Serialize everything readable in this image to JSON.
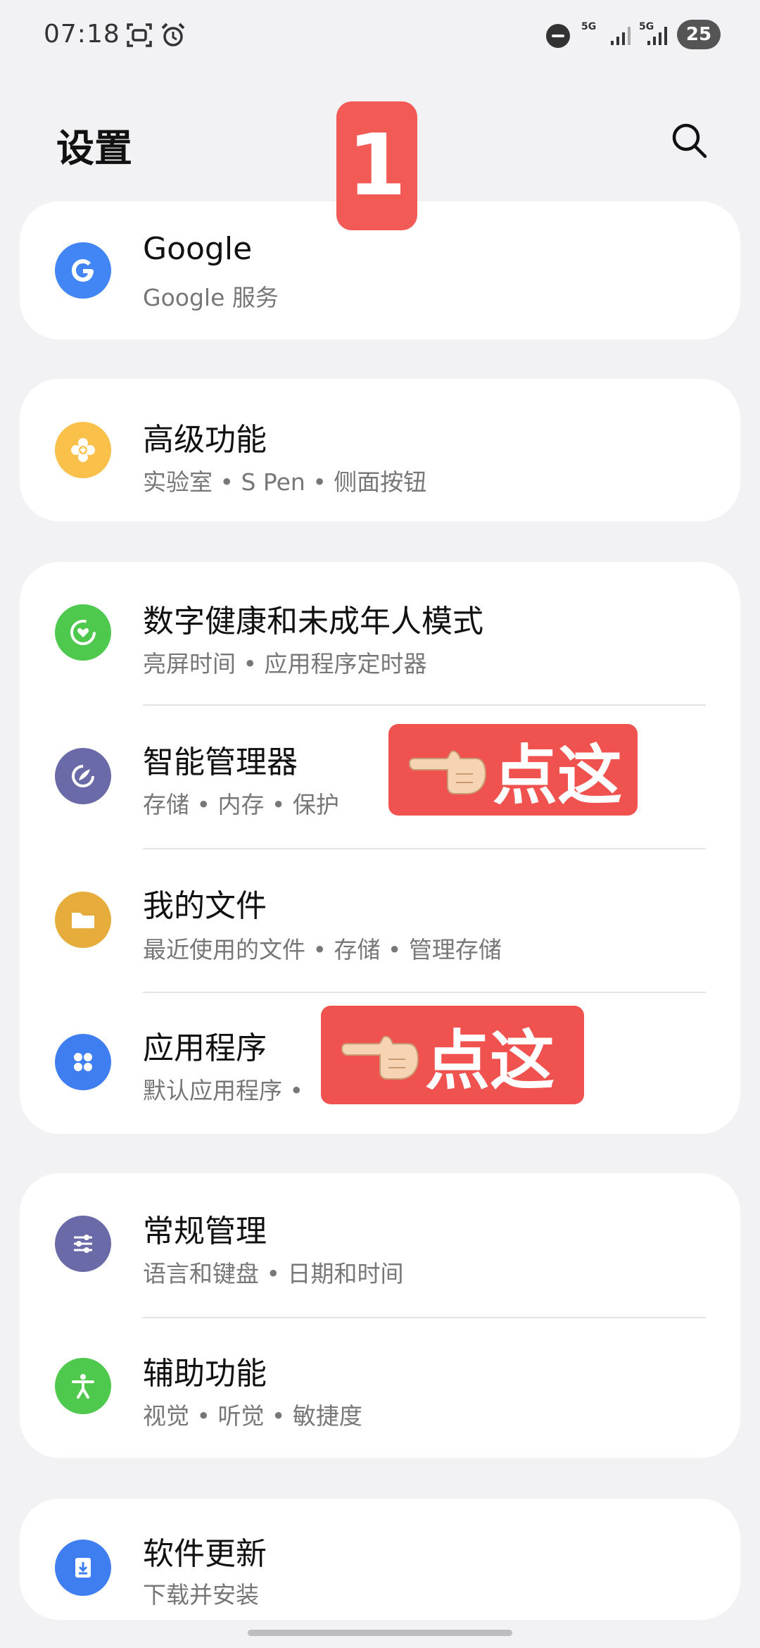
{
  "status_bar": {
    "time": "07:18",
    "network_1": "5G",
    "network_2": "5G",
    "battery": "25"
  },
  "header": {
    "title": "设置"
  },
  "overlay": {
    "step_number": "1",
    "tap_hint_1": "点这",
    "tap_hint_2": "点这"
  },
  "items": {
    "google": {
      "title": "Google",
      "subtitle": "Google 服务",
      "icon": "google-g-icon",
      "color": "#4285f4"
    },
    "advanced": {
      "title": "高级功能",
      "subtitle": "实验室 • S Pen • 侧面按钮",
      "icon": "plus-gear-icon",
      "color": "#f9c04a"
    },
    "wellbeing": {
      "title": "数字健康和未成年人模式",
      "subtitle": "亮屏时间 • 应用程序定时器",
      "icon": "heart-ring-icon",
      "color": "#4ec94e"
    },
    "device_care": {
      "title": "智能管理器",
      "subtitle": "存储 • 内存 • 保护",
      "icon": "care-leaf-icon",
      "color": "#6b6aa8"
    },
    "my_files": {
      "title": "我的文件",
      "subtitle": "最近使用的文件 • 存储 • 管理存储",
      "icon": "folder-icon",
      "color": "#e6ad3c"
    },
    "apps": {
      "title": "应用程序",
      "subtitle": "默认应用程序 •",
      "icon": "apps-grid-icon",
      "color": "#3f7ef0"
    },
    "general": {
      "title": "常规管理",
      "subtitle": "语言和键盘 • 日期和时间",
      "icon": "sliders-icon",
      "color": "#6b6aa8"
    },
    "accessibility": {
      "title": "辅助功能",
      "subtitle": "视觉 • 听觉 • 敏捷度",
      "icon": "person-icon",
      "color": "#4ec94e"
    },
    "software_update": {
      "title": "软件更新",
      "subtitle": "下载并安装",
      "icon": "download-icon",
      "color": "#3f7ef0"
    }
  }
}
